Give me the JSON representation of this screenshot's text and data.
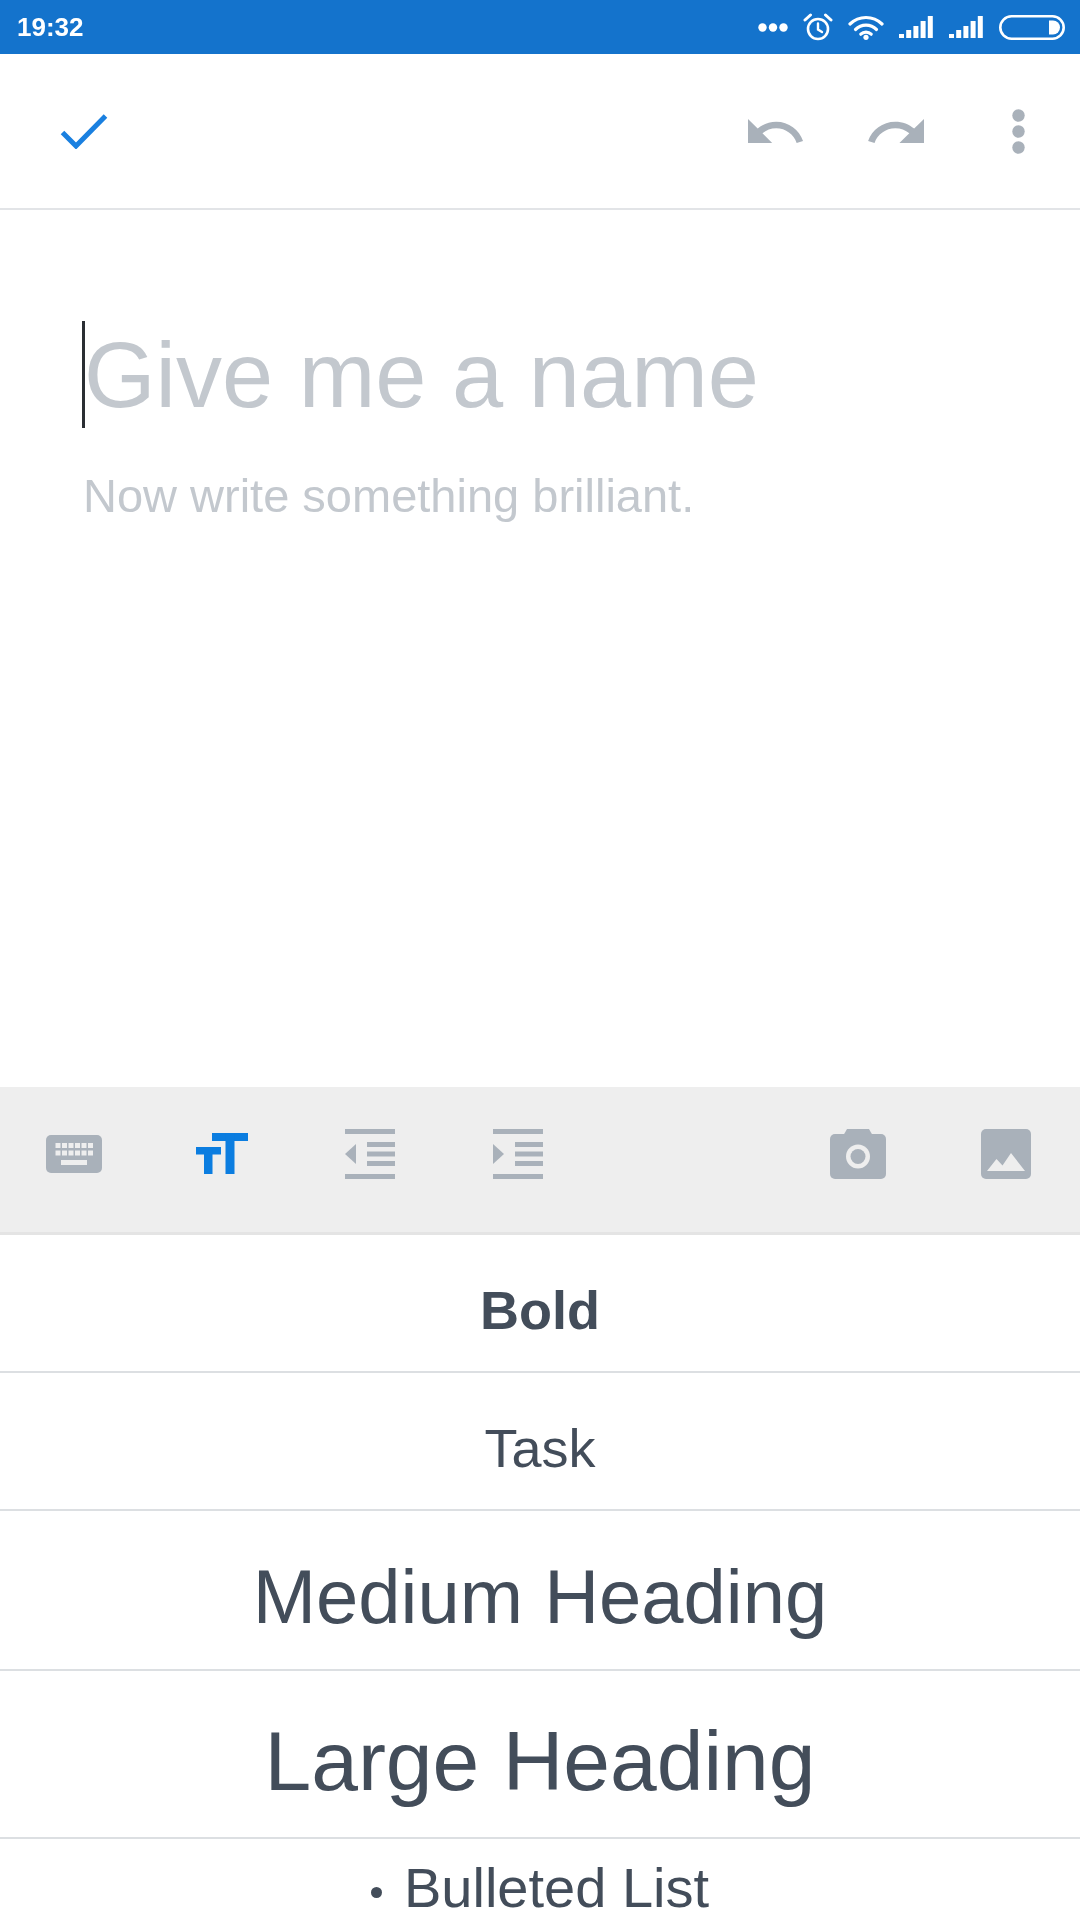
{
  "status_bar": {
    "time": "19:32"
  },
  "toolbar": {
    "actions": [
      {
        "kind": "done"
      },
      {
        "kind": "undo"
      },
      {
        "kind": "redo"
      },
      {
        "kind": "more"
      }
    ]
  },
  "editor": {
    "title": {
      "placeholder": "Give me a name",
      "focused": true
    },
    "body": {
      "placeholder": "Now write something brilliant."
    }
  },
  "format_toolbar": {
    "format_tools": [
      {
        "kind": "keyboard",
        "selected": false
      },
      {
        "kind": "text-size",
        "selected": true
      },
      {
        "kind": "outdent",
        "selected": false
      },
      {
        "kind": "indent",
        "selected": false
      }
    ],
    "insert_tools": [
      {
        "kind": "camera",
        "selected": false
      },
      {
        "kind": "image",
        "selected": false
      }
    ]
  },
  "format_menu": {
    "options": [
      {
        "kind": "bold",
        "label": "Bold"
      },
      {
        "kind": "task",
        "label": "Task"
      },
      {
        "kind": "medium-heading",
        "label": "Medium Heading"
      },
      {
        "kind": "large-heading",
        "label": "Large Heading"
      },
      {
        "kind": "bulleted-list",
        "label": "Bulleted List"
      }
    ]
  }
}
